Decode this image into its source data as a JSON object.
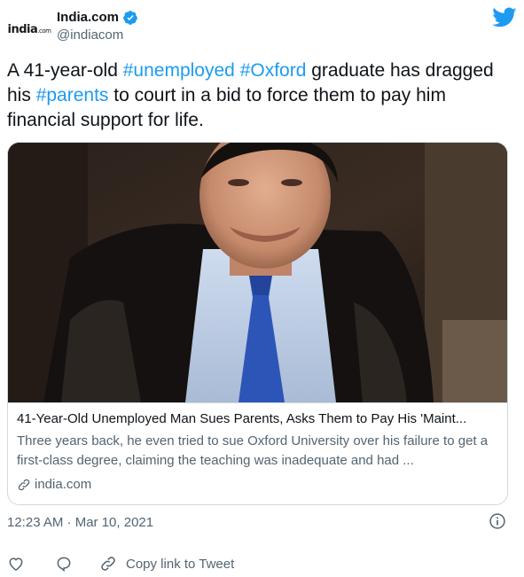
{
  "account": {
    "name": "India.com",
    "handle": "@indiacom",
    "logo_text": "india",
    "logo_suffix": ".com"
  },
  "tweet": {
    "text_before": "A 41-year-old ",
    "hashtag_1": "#unemployed",
    "space_1": " ",
    "hashtag_2": "#Oxford",
    "text_middle": " graduate has dragged his ",
    "hashtag_3": "#parents",
    "text_after": " to court in a bid to force them to pay him financial support for life."
  },
  "card": {
    "title": "41-Year-Old Unemployed Man Sues Parents, Asks Them to Pay His 'Maint...",
    "description": "Three years back, he even tried to sue Oxford University over his failure to get a first-class degree, claiming the teaching was inadequate and had ...",
    "domain": "india.com"
  },
  "meta": {
    "timestamp": "12:23 AM · Mar 10, 2021"
  },
  "actions": {
    "copy_link_label": "Copy link to Tweet"
  },
  "colors": {
    "accent": "#1d9bf0",
    "secondary_text": "#536471",
    "border": "#cfd9de"
  },
  "icons": [
    "verified-badge-icon",
    "twitter-bird-icon",
    "link-icon",
    "info-icon",
    "heart-icon",
    "reply-icon",
    "copy-link-icon"
  ]
}
